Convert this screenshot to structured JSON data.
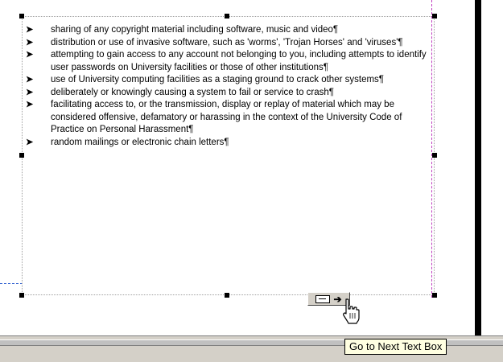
{
  "textbox": {
    "items": [
      {
        "text": "sharing of any copyright material including software, music and video¶"
      },
      {
        "text": "distribution or use of invasive software, such as 'worms', 'Trojan Horses' and 'viruses'¶"
      },
      {
        "text": "attempting to gain access to any account not belonging to you, including attempts to identify user passwords on University facilities or those of other institutions¶"
      },
      {
        "text": "use of University computing facilities as a staging ground to crack other systems¶"
      },
      {
        "text": "deliberately or knowingly causing a system to fail or service to crash¶"
      },
      {
        "text": "facilitating access to, or the transmission, display or replay of material which may be considered offensive, defamatory or harassing in the context of the University Code of Practice on Personal Harassment¶"
      },
      {
        "text": "random mailings or electronic chain letters¶"
      }
    ],
    "bullet_glyph": "➤"
  },
  "next_text_box_button": {
    "icon": "next-text-box-icon",
    "arrow": "➔"
  },
  "tooltip": {
    "text": "Go to Next Text Box"
  },
  "cursor": {
    "icon": "hand-pointer-icon"
  },
  "colors": {
    "page": "#ffffff",
    "chrome": "#d4d0c8",
    "tooltip_bg": "#ffffe1",
    "margin_guide_right": "#c040c0",
    "margin_guide_left": "#3060d0"
  }
}
